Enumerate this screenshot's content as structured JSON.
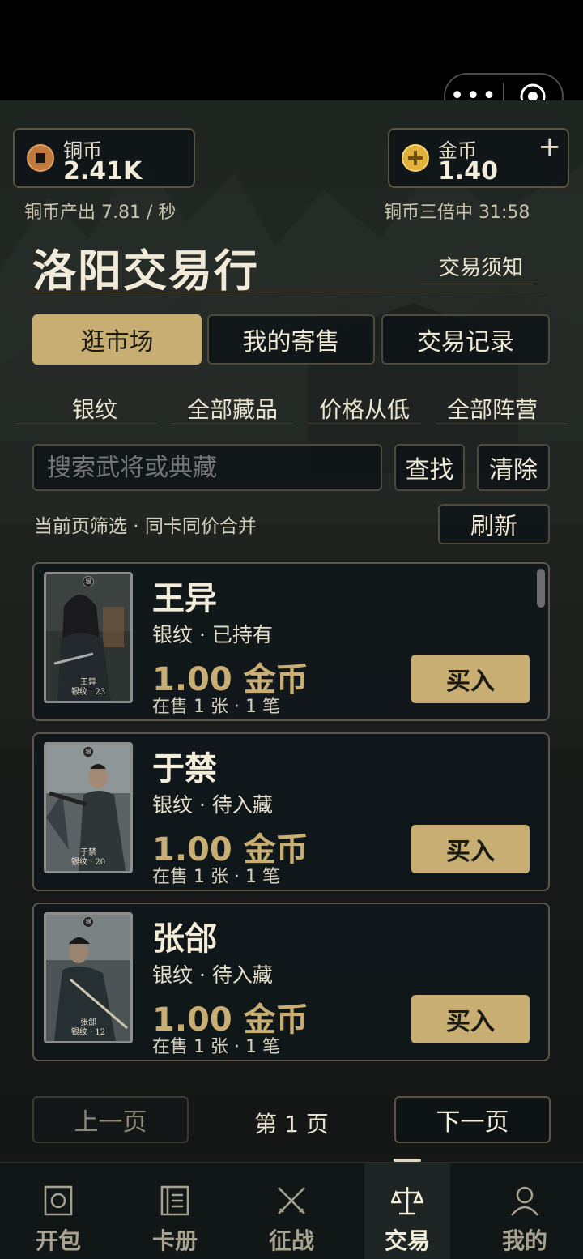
{
  "capsule": {
    "menu_icon": "more-dots-icon",
    "close_icon": "target-circle-icon"
  },
  "currency": {
    "copper": {
      "label": "铜币",
      "value": "2.41K",
      "icon": "copper-coin-icon"
    },
    "gold": {
      "label": "金币",
      "value": "1.40",
      "icon": "gold-coin-icon",
      "add_label": "+"
    },
    "copper_rate": "铜币产出 7.81 / 秒",
    "boost": "铜币三倍中 31:58"
  },
  "header": {
    "title": "洛阳交易行",
    "notice": "交易须知"
  },
  "tabs": [
    {
      "label": "逛市场",
      "active": true
    },
    {
      "label": "我的寄售",
      "active": false
    },
    {
      "label": "交易记录",
      "active": false
    }
  ],
  "filters": [
    "银纹",
    "全部藏品",
    "价格从低",
    "全部阵营"
  ],
  "search": {
    "placeholder": "搜索武将或典藏",
    "find_label": "查找",
    "clear_label": "清除"
  },
  "hint": "当前页筛选 · 同卡同价合并",
  "refresh_label": "刷新",
  "listings": [
    {
      "name": "王异",
      "status": "银纹 · 已持有",
      "price": "1.00 金币",
      "stock": "在售 1 张 · 1 笔",
      "buy_label": "买入",
      "card_name": "王异",
      "card_tag": "银纹 · 23",
      "badge": "银"
    },
    {
      "name": "于禁",
      "status": "银纹 · 待入藏",
      "price": "1.00 金币",
      "stock": "在售 1 张 · 1 笔",
      "buy_label": "买入",
      "card_name": "于禁",
      "card_tag": "银纹 · 20",
      "badge": "银"
    },
    {
      "name": "张郃",
      "status": "银纹 · 待入藏",
      "price": "1.00 金币",
      "stock": "在售 1 张 · 1 笔",
      "buy_label": "买入",
      "card_name": "张郃",
      "card_tag": "银纹 · 12",
      "badge": "银"
    }
  ],
  "pager": {
    "prev_label": "上一页",
    "page_label": "第 1 页",
    "next_label": "下一页"
  },
  "nav": [
    {
      "label": "开包",
      "icon": "pack-icon",
      "active": false
    },
    {
      "label": "卡册",
      "icon": "album-icon",
      "active": false
    },
    {
      "label": "征战",
      "icon": "crossed-swords-icon",
      "active": false
    },
    {
      "label": "交易",
      "icon": "scales-icon",
      "active": true
    },
    {
      "label": "我的",
      "icon": "user-icon",
      "active": false
    }
  ],
  "colors": {
    "accent": "#c8ae72",
    "background": "#1c201e",
    "card": "#10171a"
  }
}
